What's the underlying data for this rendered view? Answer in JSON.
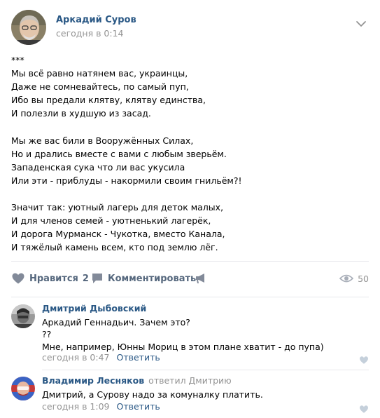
{
  "post": {
    "author": "Аркадий Суров",
    "date": "сегодня в 0:14",
    "text": "***\nМы всё равно натянем вас, украинцы,\nДаже не сомневайтесь, по самый пуп,\nИбо вы предали клятву, клятву единства,\nИ полезли в худшую из засад.\n\nМы же вас били в Вооружённых Силах,\nНо и дрались вместе с вами с любым зверьём.\nЗападенская сука что ли вас укусила\nИли эти - приблуды - накормили своим гнильём?!\n\nЗначит так: уютный лагерь для деток малых,\nИ для членов семей - уютненький лагерёк,\nИ дорога Мурманск - Чукотка, вместо Канала,\nИ тяжёлый камень всем, кто под землю лёг."
  },
  "actions": {
    "like_label": "Нравится",
    "like_count": "2",
    "comment_label": "Комментировать",
    "views_count": "50"
  },
  "comments": [
    {
      "author": "Дмитрий Дыбовский",
      "replied_to": "",
      "text": "Аркадий Геннадьич. Зачем это?\n??\nМне, например, Юнны Мориц в этом плане хватит - до пупа)",
      "date": "сегодня в 0:47",
      "reply_label": "Ответить"
    },
    {
      "author": "Владимир Лесняков",
      "replied_to": "ответил Дмитрию",
      "text": "Дмитрий, а Сурову надо за комуналку платить.",
      "date": "сегодня в 1:09",
      "reply_label": "Ответить"
    }
  ],
  "colors": {
    "link": "#2a5885",
    "meta": "#939393",
    "action": "#55677d",
    "icon": "#828a99",
    "divider": "#e7e8ec"
  }
}
